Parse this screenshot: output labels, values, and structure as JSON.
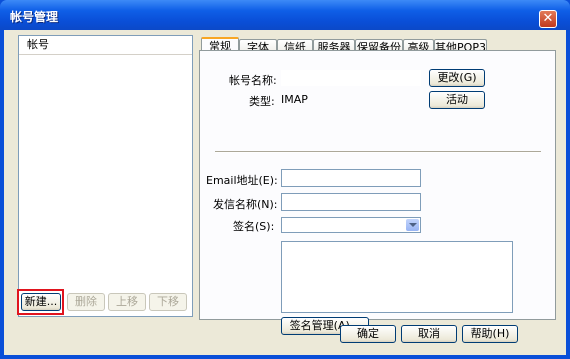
{
  "window": {
    "title": "帐号管理",
    "close_glyph": "✕"
  },
  "accounts": {
    "header": "帐号",
    "items": [],
    "buttons": {
      "new": "新建...",
      "delete": "删除",
      "move_up": "上移",
      "move_down": "下移"
    }
  },
  "tabs": [
    "常规",
    "字体",
    "信纸",
    "服务器",
    "保留备份",
    "高级",
    "其他POP3"
  ],
  "active_tab": "常规",
  "general": {
    "account_name_label": "帐号名称:",
    "account_name_value": "",
    "change_button": "更改(G)",
    "type_label": "类型:",
    "type_value": "IMAP",
    "activate_button": "活动",
    "email_label": "Email地址(E):",
    "email_value": "",
    "sender_name_label": "发信名称(N):",
    "sender_name_value": "",
    "signature_label": "签名(S):",
    "signature_value": "",
    "signature_text": "",
    "signature_manage_button": "签名管理(A)..."
  },
  "footer": {
    "ok": "确定",
    "cancel": "取消",
    "help": "帮助(H)"
  },
  "colors": {
    "title_bar": "#0a4fd8",
    "dialog_bg": "#ece9d8",
    "highlight_border": "#e0141e",
    "active_tab_accent": "#f8a624"
  }
}
